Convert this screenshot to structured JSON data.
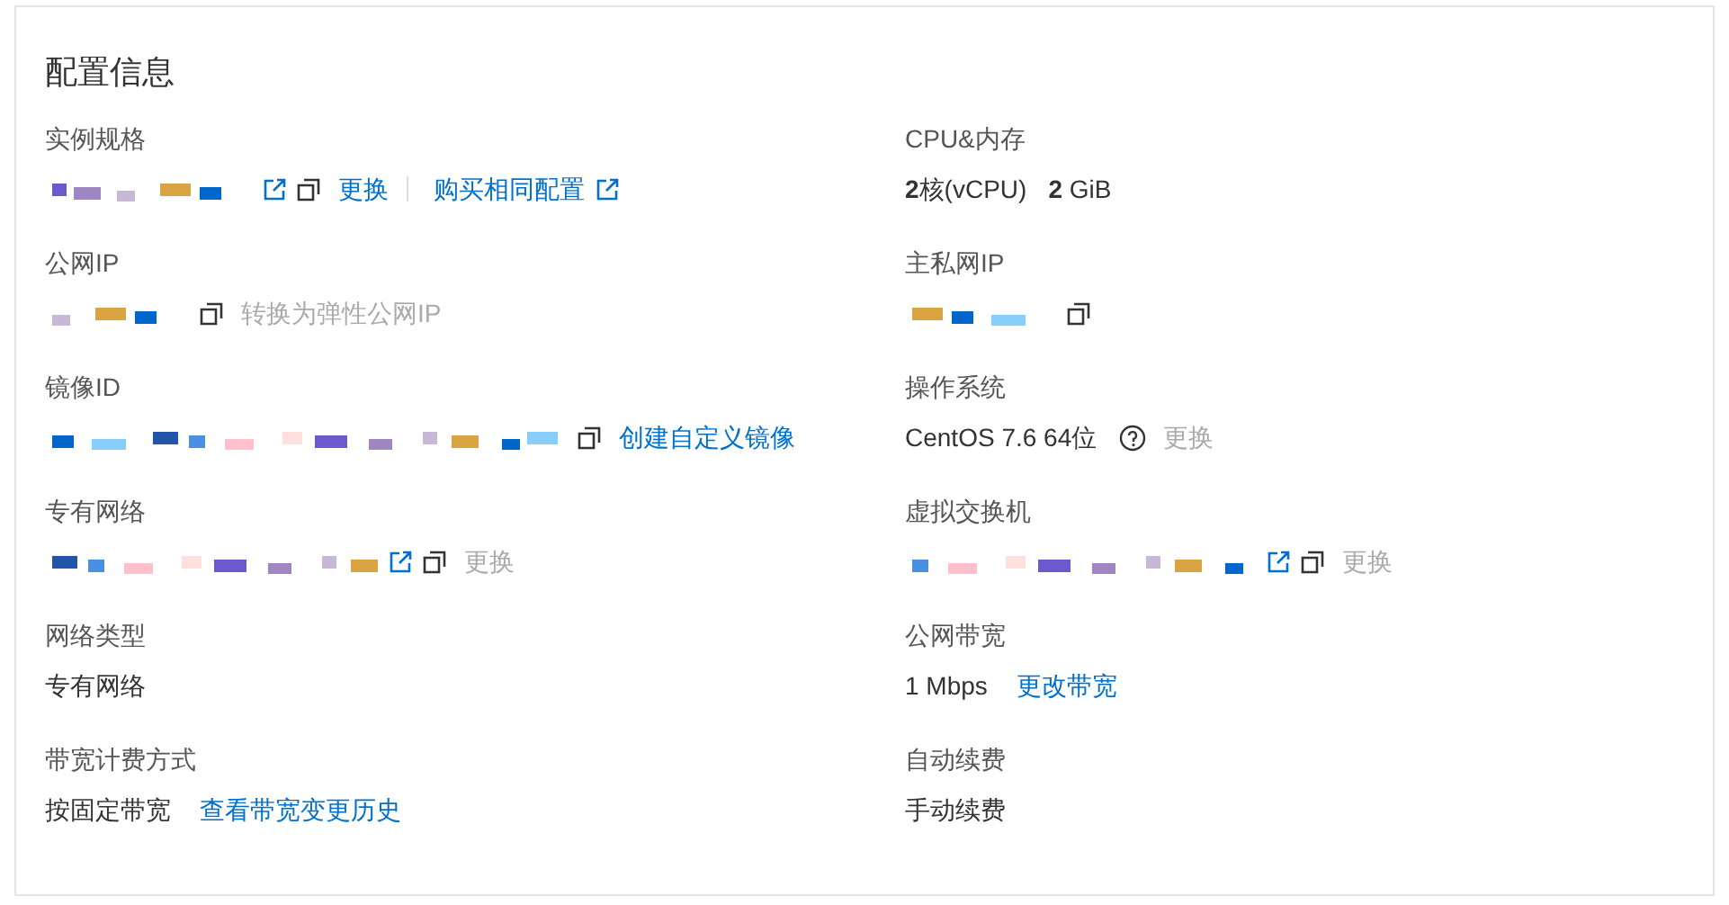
{
  "title": "配置信息",
  "fields": [
    {
      "label": "实例规格",
      "parts": [
        {
          "kind": "masked"
        },
        {
          "kind": "external"
        },
        {
          "kind": "copy"
        },
        {
          "kind": "link",
          "text": "更换",
          "disabled": false
        },
        {
          "kind": "divider"
        },
        {
          "kind": "link",
          "text": "购买相同配置",
          "disabled": false
        },
        {
          "kind": "external"
        }
      ]
    },
    {
      "label": "CPU&内存",
      "parts": [
        {
          "kind": "text",
          "text": "**2**核(vCPU)"
        },
        {
          "kind": "text",
          "text": "**2** GiB"
        }
      ]
    },
    {
      "label": "公网IP",
      "parts": [
        {
          "kind": "masked"
        },
        {
          "kind": "copy"
        },
        {
          "kind": "link",
          "text": "转换为弹性公网IP",
          "disabled": true
        }
      ]
    },
    {
      "label": "主私网IP",
      "parts": [
        {
          "kind": "masked"
        },
        {
          "kind": "copy"
        }
      ]
    },
    {
      "label": "镜像ID",
      "parts": [
        {
          "kind": "masked"
        },
        {
          "kind": "copy"
        },
        {
          "kind": "link",
          "text": "创建自定义镜像",
          "disabled": false
        }
      ]
    },
    {
      "label": "操作系统",
      "parts": [
        {
          "kind": "text",
          "text": "CentOS 7.6 64位"
        },
        {
          "kind": "help"
        },
        {
          "kind": "link",
          "text": "更换",
          "disabled": true
        }
      ]
    },
    {
      "label": "专有网络",
      "parts": [
        {
          "kind": "masked"
        },
        {
          "kind": "external"
        },
        {
          "kind": "copy"
        },
        {
          "kind": "link",
          "text": "更换",
          "disabled": true
        }
      ]
    },
    {
      "label": "虚拟交换机",
      "parts": [
        {
          "kind": "masked"
        },
        {
          "kind": "external"
        },
        {
          "kind": "copy"
        },
        {
          "kind": "link",
          "text": "更换",
          "disabled": true
        }
      ]
    },
    {
      "label": "网络类型",
      "parts": [
        {
          "kind": "text",
          "text": "专有网络"
        }
      ]
    },
    {
      "label": "公网带宽",
      "parts": [
        {
          "kind": "text",
          "text": "1 Mbps"
        },
        {
          "kind": "link",
          "text": "更改带宽",
          "disabled": false
        }
      ]
    },
    {
      "label": "带宽计费方式",
      "parts": [
        {
          "kind": "text",
          "text": "按固定带宽"
        },
        {
          "kind": "link",
          "text": "查看带宽变更历史",
          "disabled": false
        }
      ]
    },
    {
      "label": "自动续费",
      "parts": [
        {
          "kind": "text",
          "text": "手动续费"
        }
      ]
    }
  ]
}
